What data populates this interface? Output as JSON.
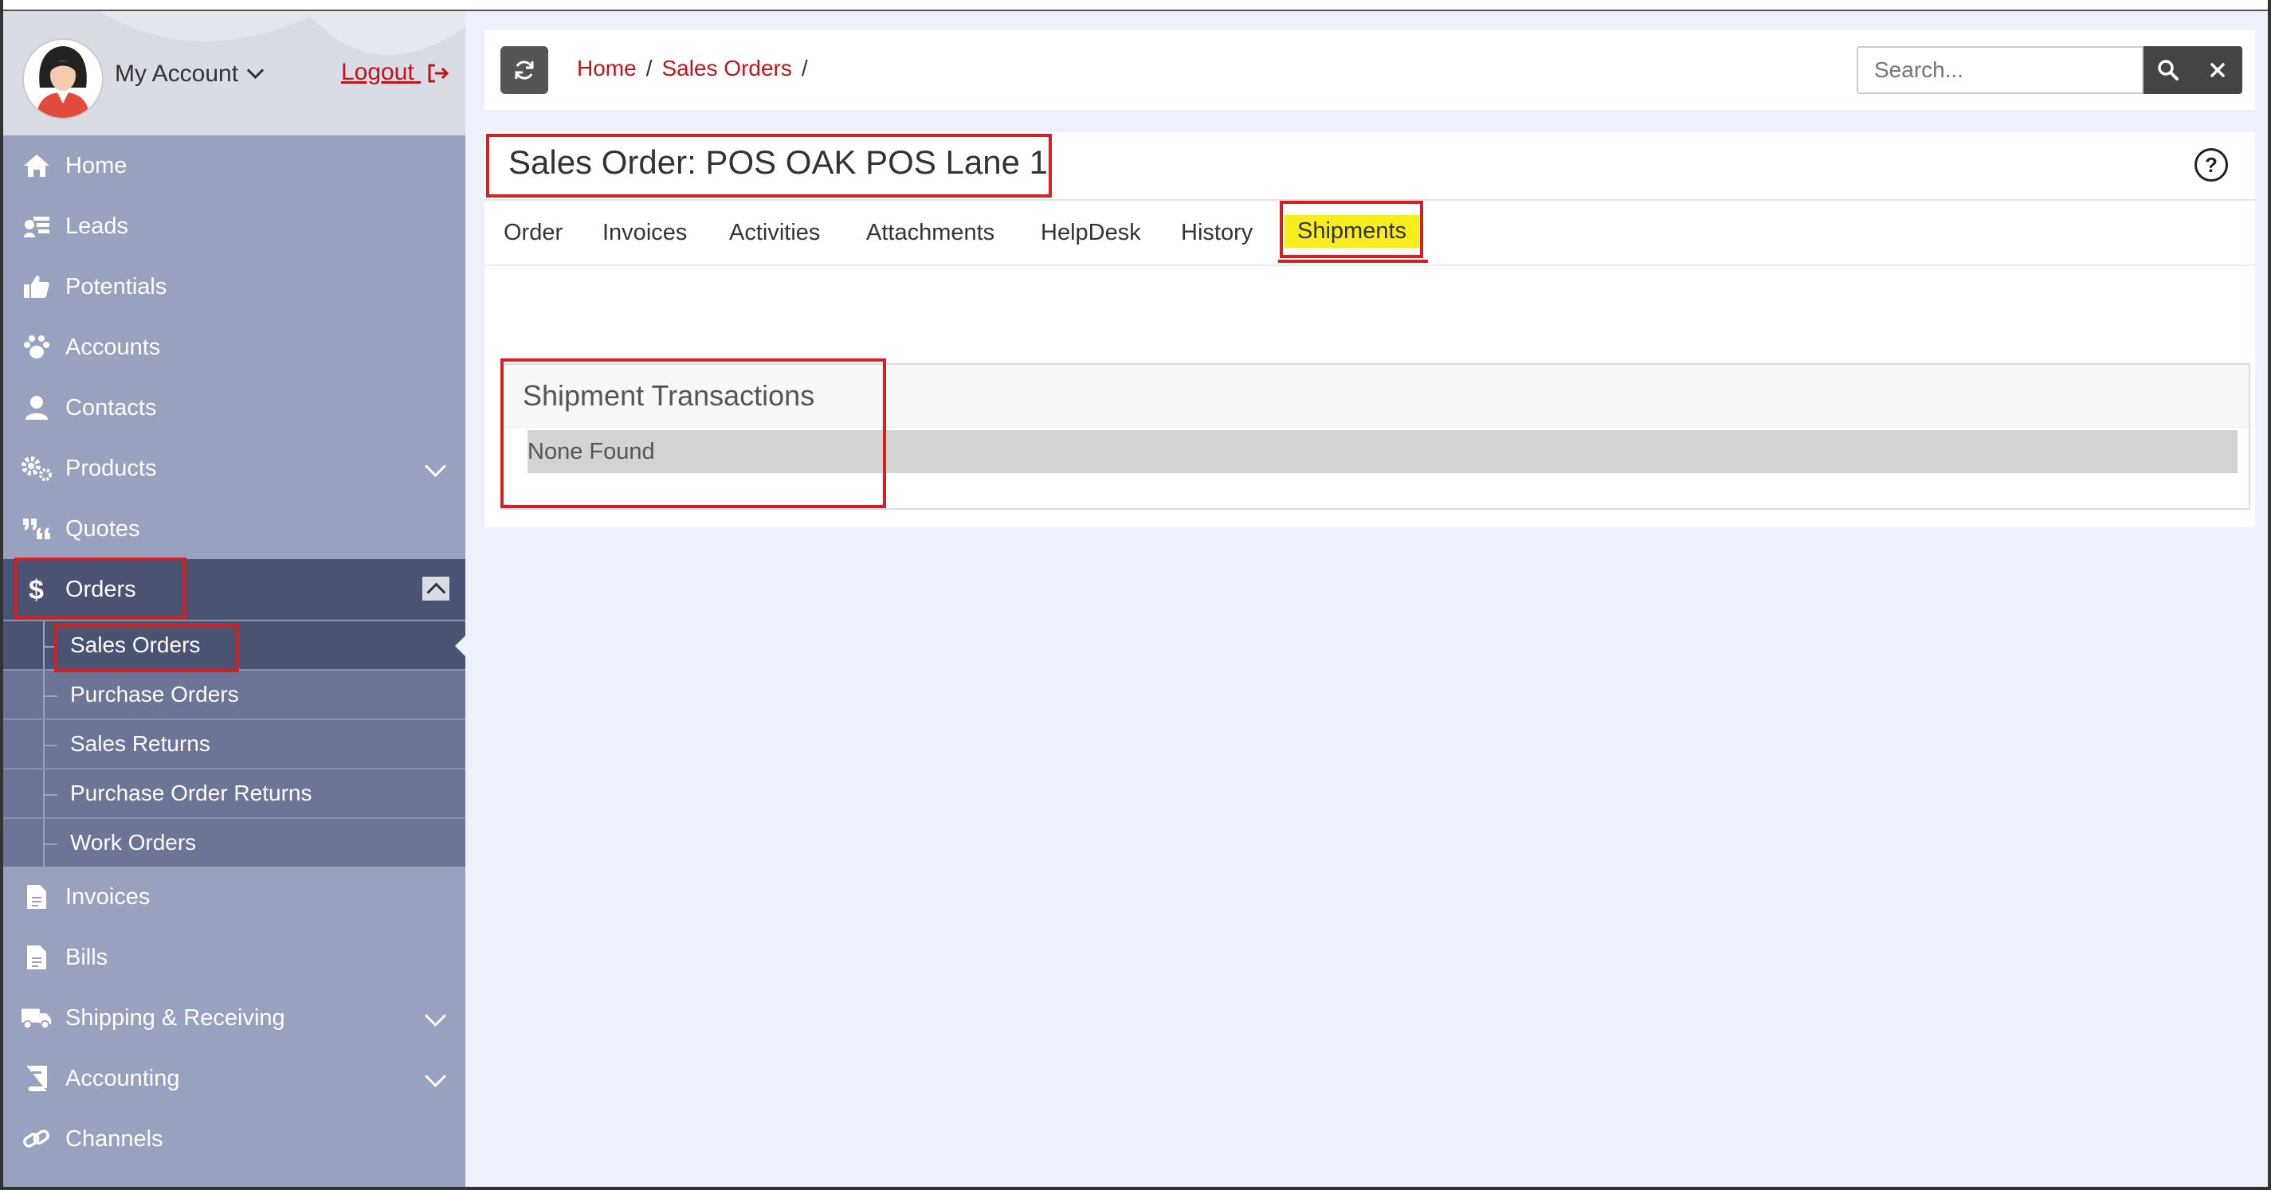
{
  "account": {
    "label": "My Account",
    "logout": "Logout"
  },
  "sidebar": {
    "items": [
      {
        "label": "Home",
        "icon": "home-icon"
      },
      {
        "label": "Leads",
        "icon": "leads-icon"
      },
      {
        "label": "Potentials",
        "icon": "thumbs-up-icon"
      },
      {
        "label": "Accounts",
        "icon": "paw-icon"
      },
      {
        "label": "Contacts",
        "icon": "user-icon"
      },
      {
        "label": "Products",
        "icon": "gears-icon"
      },
      {
        "label": "Quotes",
        "icon": "quote-icon"
      },
      {
        "label": "Orders",
        "icon": "dollar-icon"
      },
      {
        "label": "Invoices",
        "icon": "document-icon"
      },
      {
        "label": "Bills",
        "icon": "document-icon"
      },
      {
        "label": "Shipping & Receiving",
        "icon": "truck-icon"
      },
      {
        "label": "Accounting",
        "icon": "book-icon"
      },
      {
        "label": "Channels",
        "icon": "link-icon"
      }
    ],
    "orders_sub": [
      {
        "label": "Sales Orders"
      },
      {
        "label": "Purchase Orders"
      },
      {
        "label": "Sales Returns"
      },
      {
        "label": "Purchase Order Returns"
      },
      {
        "label": "Work Orders"
      }
    ]
  },
  "topbar": {
    "breadcrumb": [
      "Home",
      "Sales Orders"
    ],
    "search_placeholder": "Search..."
  },
  "main": {
    "title": "Sales Order: POS OAK POS Lane 1",
    "tabs": [
      "Order",
      "Invoices",
      "Activities",
      "Attachments",
      "HelpDesk",
      "History",
      "Shipments"
    ],
    "active_tab": "Shipments",
    "panel_title": "Shipment Transactions",
    "empty_text": "None Found"
  },
  "colors": {
    "sidebar": "#98a2bf",
    "active": "#4a5372",
    "accent_red": "#c0141b",
    "highlight_yellow": "#f7ed1f"
  }
}
